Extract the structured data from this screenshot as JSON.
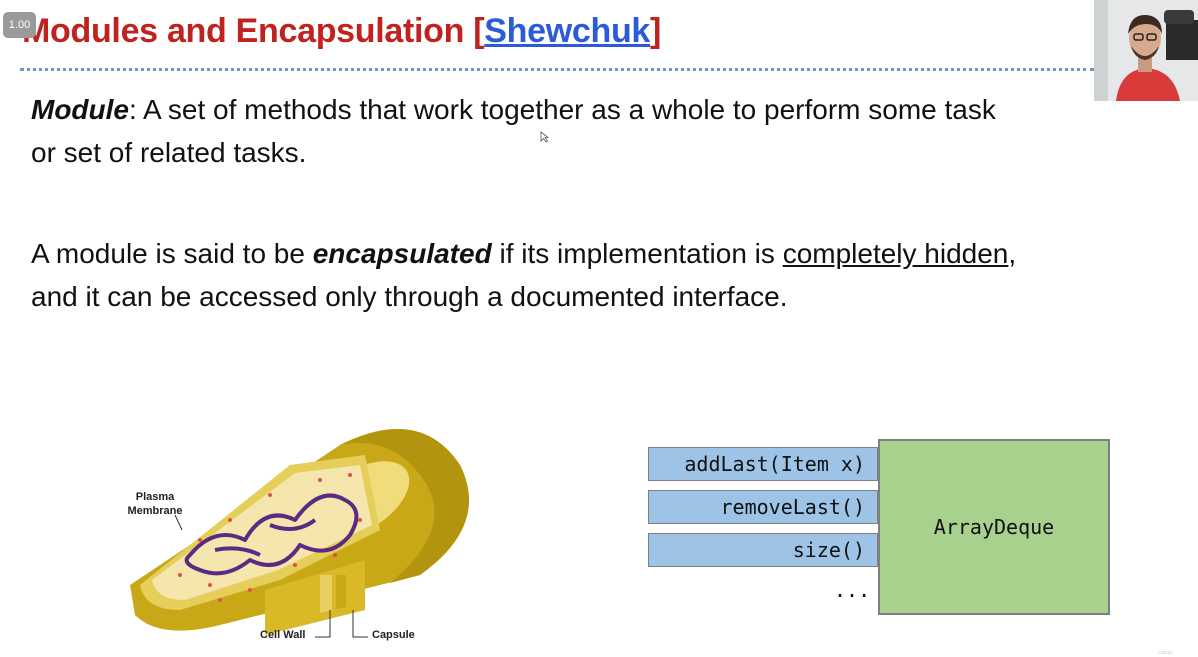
{
  "player": {
    "speed_label": "1.00"
  },
  "slide": {
    "title": "Modules and Encapsulation [",
    "title_link": "Shewchuk",
    "title_end": "]",
    "para1": {
      "term": "Module",
      "line1_rest": ": A set of methods that work together as a whole to perform some task",
      "line2": "or set of related tasks."
    },
    "para2": {
      "prefix": "A module is said to be ",
      "term": "encapsulated",
      "middle": " if its implementation is ",
      "underlined": "completely hidden",
      "comma": ",",
      "line2": "and it can be accessed only through a documented interface."
    },
    "cell_labels": {
      "plasma": "Plasma",
      "membrane": "Membrane",
      "cell_wall": "Cell Wall",
      "capsule": "Capsule"
    },
    "deque": {
      "methods": [
        "addLast(Item x)",
        "removeLast()",
        "size()"
      ],
      "ellipsis": "...",
      "class_name": "ArrayDeque"
    },
    "colors": {
      "title_red": "#c0221f",
      "link_blue": "#2b5bd8",
      "method_blue": "#9dc3e6",
      "class_green": "#a9d18e"
    }
  }
}
